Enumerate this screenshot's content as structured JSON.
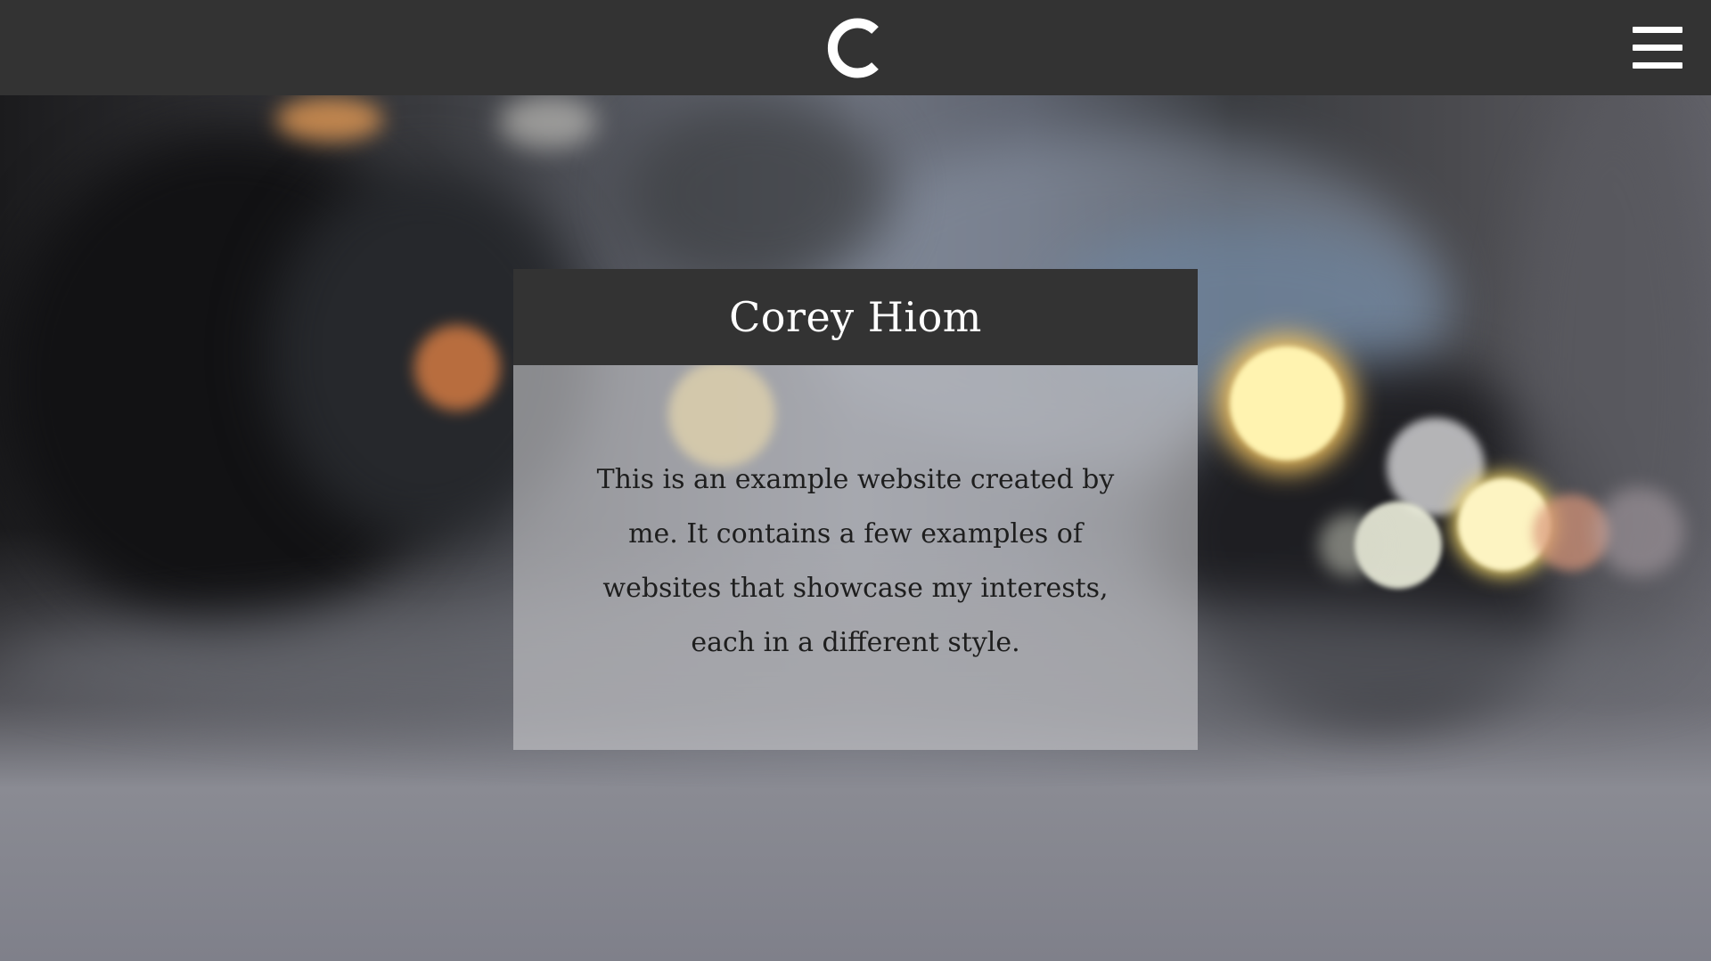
{
  "navbar": {
    "logo_letter": "C",
    "logo_icon": "c-logo-icon",
    "menu_icon": "hamburger-menu-icon"
  },
  "card": {
    "title": "Corey Hiom",
    "body": "This is an example website created by me. It contains a few examples of websites that showcase my interests, each in a different style."
  },
  "colors": {
    "navbar": "#333333",
    "card_header": "#333333",
    "card_body": "#c8c8cc",
    "text_light": "#ffffff",
    "text_dark": "#1e1e1e"
  }
}
